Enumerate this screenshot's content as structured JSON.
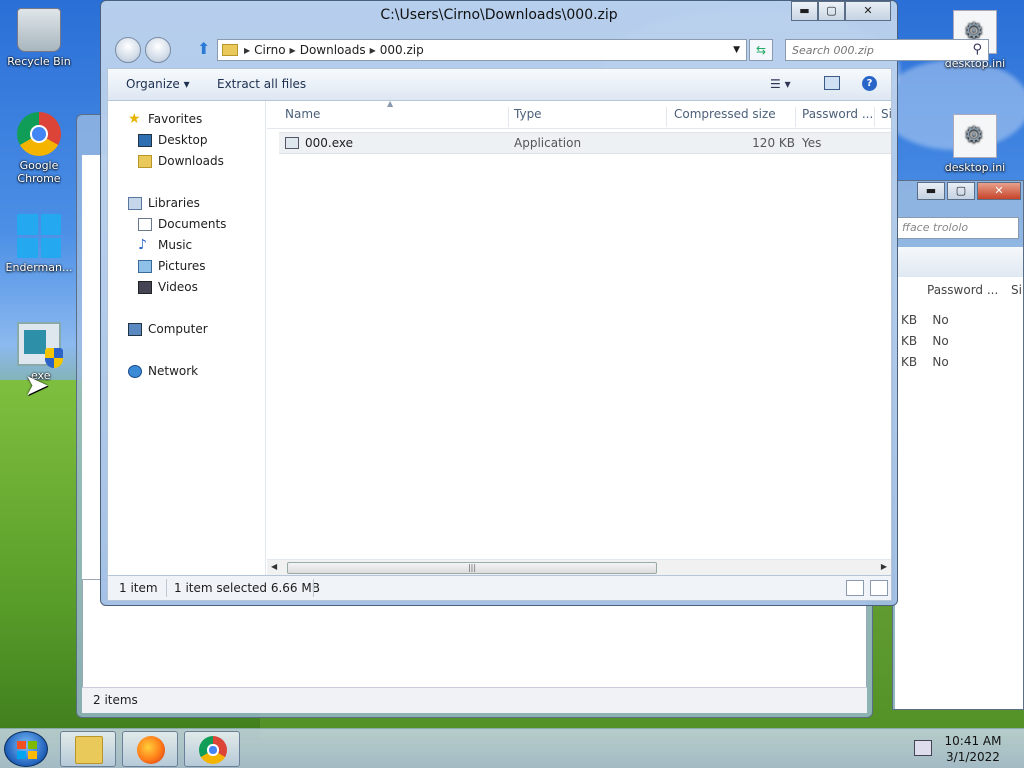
{
  "desktop": {
    "icons": [
      {
        "label": "Recycle Bin"
      },
      {
        "label": "Google Chrome"
      },
      {
        "label": "Enderman..."
      },
      {
        "label": ".exe"
      },
      {
        "label": "desktop.ini"
      },
      {
        "label": "desktop.ini"
      }
    ]
  },
  "window": {
    "title": "C:\\Users\\Cirno\\Downloads\\000.zip",
    "address": {
      "crumbs": [
        "Cirno",
        "Downloads",
        "000.zip"
      ]
    },
    "search": {
      "placeholder": "Search 000.zip"
    },
    "toolbar": {
      "organize": "Organize ▾",
      "extract": "Extract all files"
    },
    "nav": {
      "favorites": "Favorites",
      "desktop": "Desktop",
      "downloads": "Downloads",
      "libraries": "Libraries",
      "documents": "Documents",
      "music": "Music",
      "pictures": "Pictures",
      "videos": "Videos",
      "computer": "Computer",
      "network": "Network"
    },
    "columns": {
      "name": "Name",
      "type": "Type",
      "compressed": "Compressed size",
      "password": "Password ...",
      "size": "Si"
    },
    "files": [
      {
        "name": "000.exe",
        "type": "Application",
        "compressed": "120 KB",
        "password": "Yes"
      }
    ],
    "status": {
      "count": "1 item",
      "selected": "1 item selected  6.66 MB"
    }
  },
  "back_window": {
    "search_placeholder": "fface trololo",
    "password_col": "Password ...",
    "size_col": "Si",
    "rows": [
      {
        "kb": "KB",
        "pw": "No"
      },
      {
        "kb": "KB",
        "pw": "No"
      },
      {
        "kb": "KB",
        "pw": "No"
      }
    ],
    "status": "2 items"
  },
  "clock": {
    "time": "10:41 AM",
    "date": "3/1/2022"
  }
}
